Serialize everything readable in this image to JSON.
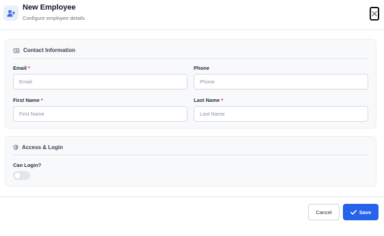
{
  "dialog": {
    "title": "New Employee",
    "subtitle": "Configure employee details",
    "header_icon": "user-plus-icon",
    "close_icon": "close-icon"
  },
  "contact_section": {
    "title": "Contact Information",
    "icon": "id-card-icon",
    "fields": {
      "email": {
        "label": "Email",
        "required": "*",
        "placeholder": "Email",
        "value": ""
      },
      "phone": {
        "label": "Phone",
        "placeholder": "Phone",
        "value": ""
      },
      "first_name": {
        "label": "First Name",
        "required": "*",
        "placeholder": "First Name",
        "value": ""
      },
      "last_name": {
        "label": "Last Name",
        "required": "*",
        "placeholder": "Last Name",
        "value": ""
      }
    }
  },
  "access_section": {
    "title": "Access & Login",
    "icon": "shield-icon",
    "can_login": {
      "label": "Can Login?",
      "enabled": false
    }
  },
  "footer": {
    "cancel_label": "Cancel",
    "save_label": "Save",
    "save_icon": "check-icon"
  },
  "colors": {
    "primary": "#2563eb",
    "required": "#dc2626",
    "icon_bg": "#e8f0fd",
    "card_bg": "#f8f9fb"
  }
}
